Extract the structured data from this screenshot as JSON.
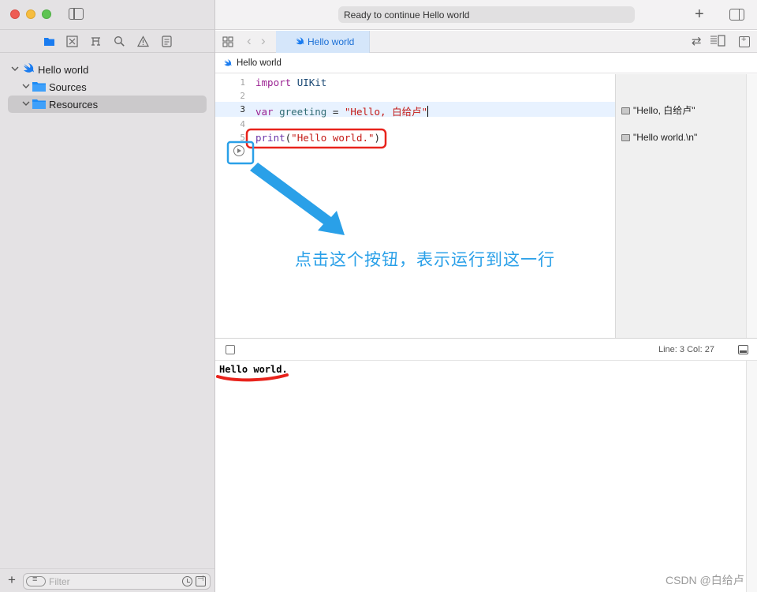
{
  "navigator": {
    "project_name": "Hello world",
    "tree": [
      {
        "label": "Hello world"
      },
      {
        "label": "Sources"
      },
      {
        "label": "Resources"
      }
    ],
    "filter_placeholder": "Filter"
  },
  "toolbar": {
    "activity_status": "Ready to continue Hello world"
  },
  "editor": {
    "tab_label": "Hello world",
    "jump_bar": "Hello world",
    "code_lines": [
      {
        "number": "1",
        "text": "import UIKit"
      },
      {
        "number": "2",
        "text": ""
      },
      {
        "number": "3",
        "text": "var greeting = \"Hello, 白给卢\""
      },
      {
        "number": "4",
        "text": ""
      },
      {
        "number": "5",
        "text": "print(\"Hello world.\")"
      }
    ],
    "results": [
      {
        "line": "3",
        "value": "\"Hello, 白给卢\""
      },
      {
        "line": "5",
        "value": "\"Hello world.\\n\""
      }
    ]
  },
  "status": {
    "cursor_position": "Line: 3  Col: 27"
  },
  "console": {
    "output": "Hello world."
  },
  "annotation": {
    "text": "点击这个按钮，表示运行到这一行",
    "arrow_color": "#2aa0e8",
    "highlight_red": "#e8231c",
    "highlight_blue": "#2aa0e8"
  },
  "watermark": "CSDN @白给卢"
}
